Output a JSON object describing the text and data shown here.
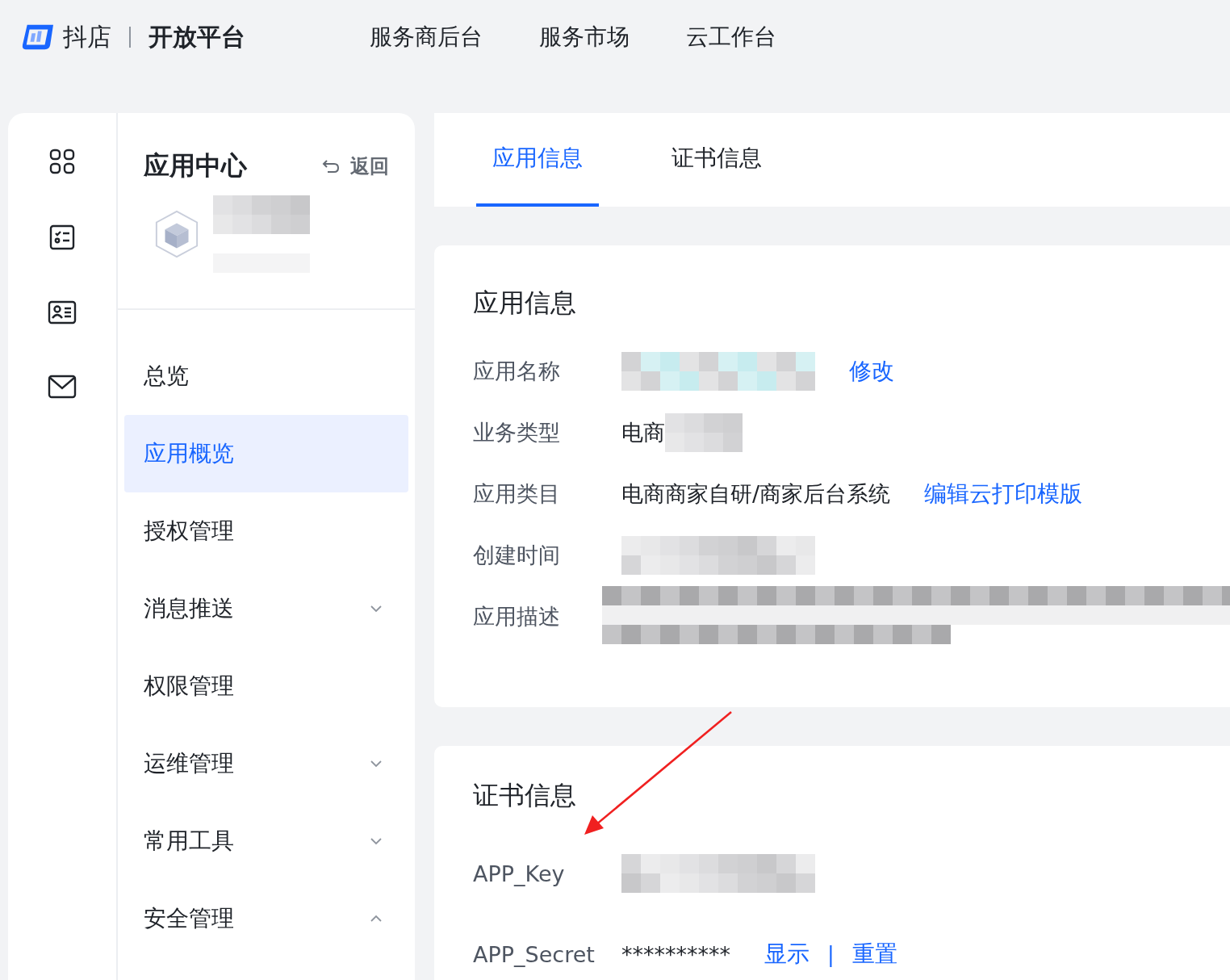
{
  "header": {
    "brand": "抖店",
    "platform": "开放平台",
    "nav": [
      {
        "label": "服务商后台"
      },
      {
        "label": "服务市场"
      },
      {
        "label": "云工作台"
      }
    ]
  },
  "rail": {
    "icons": [
      {
        "kind": "grid"
      },
      {
        "kind": "checklist"
      },
      {
        "kind": "contact"
      },
      {
        "kind": "mail"
      }
    ]
  },
  "sidebar": {
    "title": "应用中心",
    "back": "返回",
    "app": {
      "redacted": true
    },
    "items": [
      {
        "label": "总览",
        "kind": "link",
        "selected": false
      },
      {
        "label": "应用概览",
        "kind": "link",
        "selected": true
      },
      {
        "label": "授权管理",
        "kind": "link",
        "selected": false
      },
      {
        "label": "消息推送",
        "kind": "group",
        "selected": false,
        "expanded": false
      },
      {
        "label": "权限管理",
        "kind": "link",
        "selected": false
      },
      {
        "label": "运维管理",
        "kind": "group",
        "selected": false,
        "expanded": false
      },
      {
        "label": "常用工具",
        "kind": "group",
        "selected": false,
        "expanded": false
      },
      {
        "label": "安全管理",
        "kind": "group",
        "selected": false,
        "expanded": true
      }
    ]
  },
  "tabs": [
    {
      "label": "应用信息",
      "selected": true
    },
    {
      "label": "证书信息",
      "selected": false
    }
  ],
  "app_info": {
    "title": "应用信息",
    "rows": [
      {
        "label": "应用名称",
        "kind": "line",
        "redacted": true,
        "actions": [
          {
            "label": "修改"
          }
        ]
      },
      {
        "label": "业务类型",
        "kind": "line",
        "value": "电商",
        "redacted": true
      },
      {
        "label": "应用类目",
        "kind": "line",
        "value": "电商商家自研/商家后台系统",
        "redacted": false,
        "actions": [
          {
            "label": "编辑云打印模版"
          }
        ]
      },
      {
        "label": "创建时间",
        "kind": "line",
        "redacted": true
      },
      {
        "label": "应用描述",
        "kind": "paragraph",
        "redacted": true
      }
    ]
  },
  "cert_info": {
    "title": "证书信息",
    "rows": [
      {
        "label": "APP_Key",
        "redacted": true
      },
      {
        "label": "APP_Secret",
        "value": "**********",
        "redacted": false,
        "actions": [
          {
            "label": "显示"
          },
          {
            "label": "重置"
          }
        ],
        "separator": "|"
      }
    ]
  },
  "annotation": {
    "kind": "arrow"
  }
}
